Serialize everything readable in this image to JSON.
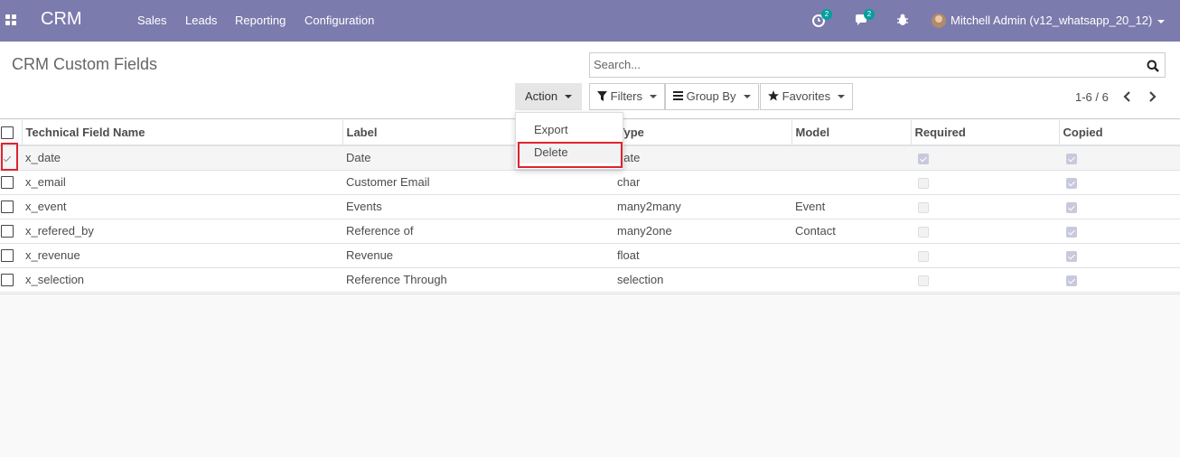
{
  "navbar": {
    "brand": "CRM",
    "menu": [
      "Sales",
      "Leads",
      "Reporting",
      "Configuration"
    ],
    "activity_count": "2",
    "messages_count": "2",
    "user_name": "Mitchell Admin (v12_whatsapp_20_12)"
  },
  "control_panel": {
    "title": "CRM Custom Fields",
    "search_placeholder": "Search...",
    "action_label": "Action",
    "filters_label": "Filters",
    "group_by_label": "Group By",
    "favorites_label": "Favorites",
    "pager": "1-6 / 6"
  },
  "action_menu": {
    "items": [
      "Export",
      "Delete"
    ]
  },
  "table": {
    "columns": [
      "Technical Field Name",
      "Label",
      "Type",
      "Model",
      "Required",
      "Copied"
    ],
    "rows": [
      {
        "name": "x_date",
        "label": "Date",
        "type": "date",
        "model": "",
        "required": true,
        "copied": true,
        "selected": true
      },
      {
        "name": "x_email",
        "label": "Customer Email",
        "type": "char",
        "model": "",
        "required": false,
        "copied": true,
        "selected": false
      },
      {
        "name": "x_event",
        "label": "Events",
        "type": "many2many",
        "model": "Event",
        "required": false,
        "copied": true,
        "selected": false
      },
      {
        "name": "x_refered_by",
        "label": "Reference of",
        "type": "many2one",
        "model": "Contact",
        "required": false,
        "copied": true,
        "selected": false
      },
      {
        "name": "x_revenue",
        "label": "Revenue",
        "type": "float",
        "model": "",
        "required": false,
        "copied": true,
        "selected": false
      },
      {
        "name": "x_selection",
        "label": "Reference Through",
        "type": "selection",
        "model": "",
        "required": false,
        "copied": true,
        "selected": false
      }
    ]
  },
  "colors": {
    "navbar": "#7c7bad",
    "badge": "#00a09d",
    "highlight": "#e0232e"
  }
}
